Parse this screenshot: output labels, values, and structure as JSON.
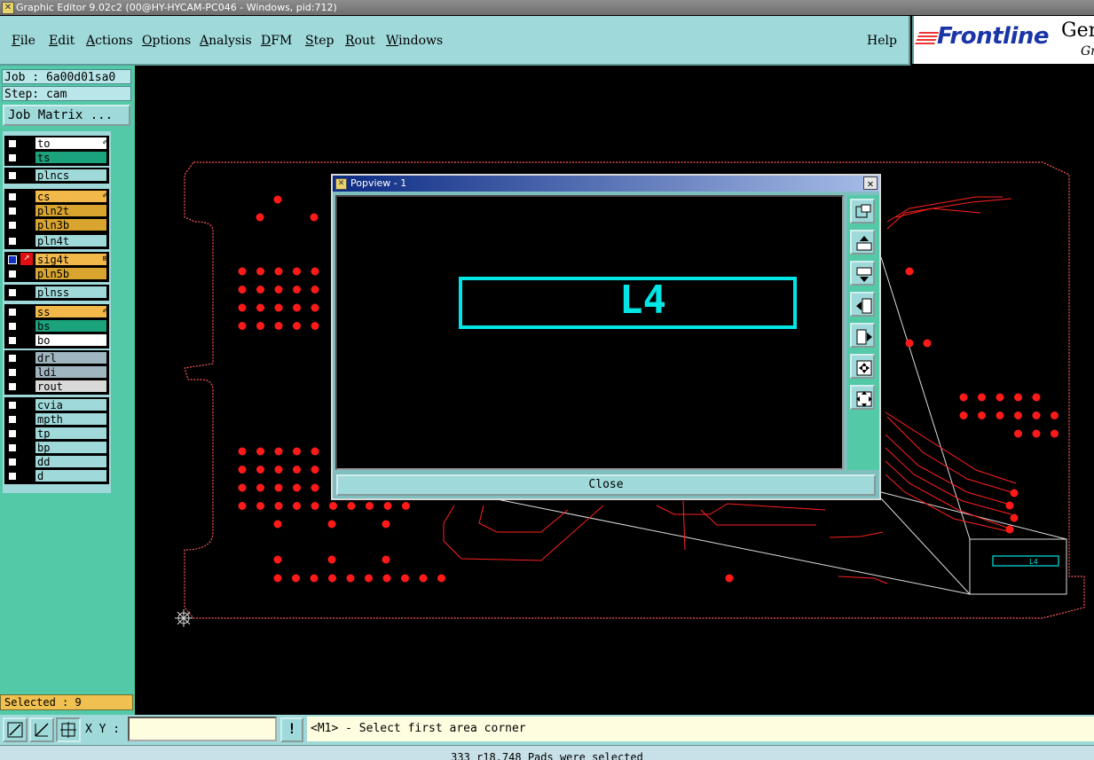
{
  "window": {
    "title": "Graphic Editor 9.02c2 (00@HY-HYCAM-PC046 - Windows, pid:712)"
  },
  "menu": {
    "items": [
      {
        "label": "File",
        "u": "F",
        "rest": "ile"
      },
      {
        "label": "Edit",
        "u": "E",
        "rest": "dit"
      },
      {
        "label": "Actions",
        "u": "A",
        "rest": "ctions"
      },
      {
        "label": "Options",
        "u": "O",
        "rest": "ptions"
      },
      {
        "label": "Analysis",
        "u": "A",
        "rest": "nalysis"
      },
      {
        "label": "DFM",
        "u": "D",
        "rest": "FM"
      },
      {
        "label": "Step",
        "u": "S",
        "rest": "tep"
      },
      {
        "label": "Rout",
        "u": "R",
        "rest": "out"
      },
      {
        "label": "Windows",
        "u": "W",
        "rest": "indows"
      }
    ],
    "help": "Help"
  },
  "logo": {
    "brand": "Frontline",
    "product": "Gen",
    "sub": "Gr"
  },
  "job": {
    "job_line": "Job : 6a00d01sa0",
    "step_line": "Step: cam",
    "matrix_button": "Job Matrix ..."
  },
  "layers": [
    {
      "name": "to",
      "color": "#ffffff",
      "mark": "✐"
    },
    {
      "name": "ts",
      "color": "#1aa37d",
      "mark": ""
    },
    {
      "name": "plncs",
      "color": "#9fd9da",
      "mark": ""
    },
    {
      "name": "cs",
      "color": "#f2b94a",
      "mark": "✐"
    },
    {
      "name": "pln2t",
      "color": "#d9a52f",
      "mark": ""
    },
    {
      "name": "pln3b",
      "color": "#d9a52f",
      "mark": ""
    },
    {
      "name": "pln4t",
      "color": "#9fd9da",
      "mark": ""
    },
    {
      "name": "sig4t",
      "color": "#f2b94a",
      "mark": "⊞",
      "active": true
    },
    {
      "name": "pln5b",
      "color": "#d9a52f",
      "mark": ""
    },
    {
      "name": "plnss",
      "color": "#9fd9da",
      "mark": ""
    },
    {
      "name": "ss",
      "color": "#f2b94a",
      "mark": "✐"
    },
    {
      "name": "bs",
      "color": "#1aa37d",
      "mark": ""
    },
    {
      "name": "bo",
      "color": "#ffffff",
      "mark": ""
    },
    {
      "name": "drl",
      "color": "#9fb6c0",
      "mark": ""
    },
    {
      "name": "ldi",
      "color": "#9fb6c0",
      "mark": ""
    },
    {
      "name": "rout",
      "color": "#d9d9d9",
      "mark": ""
    },
    {
      "name": "cvia",
      "color": "#9fd9da",
      "mark": ""
    },
    {
      "name": "mpth",
      "color": "#9fd9da",
      "mark": ""
    },
    {
      "name": "tp",
      "color": "#9fd9da",
      "mark": ""
    },
    {
      "name": "bp",
      "color": "#9fd9da",
      "mark": ""
    },
    {
      "name": "dd",
      "color": "#9fd9da",
      "mark": ""
    },
    {
      "name": "d",
      "color": "#9fd9da",
      "mark": ""
    }
  ],
  "selected": "Selected : 9",
  "popview": {
    "title": "Popview - 1",
    "label": "L4",
    "close_button": "Close",
    "tools": [
      "zoom-fit-icon",
      "pan-up-icon",
      "pan-down-icon",
      "pan-left-icon",
      "pan-right-icon",
      "zoom-in-icon",
      "zoom-out-icon"
    ]
  },
  "preview_label": "L4",
  "command": {
    "xy_label": "X Y :",
    "xy_value": "",
    "alert_icon": "!",
    "message": "<M1> - Select first area corner"
  },
  "status": "333 r18.748 Pads were selected",
  "colors": {
    "pad": "#ff1a1a",
    "outline": "#ff5a5a",
    "accent": "#00e5e5",
    "panel": "#9fd9da"
  }
}
